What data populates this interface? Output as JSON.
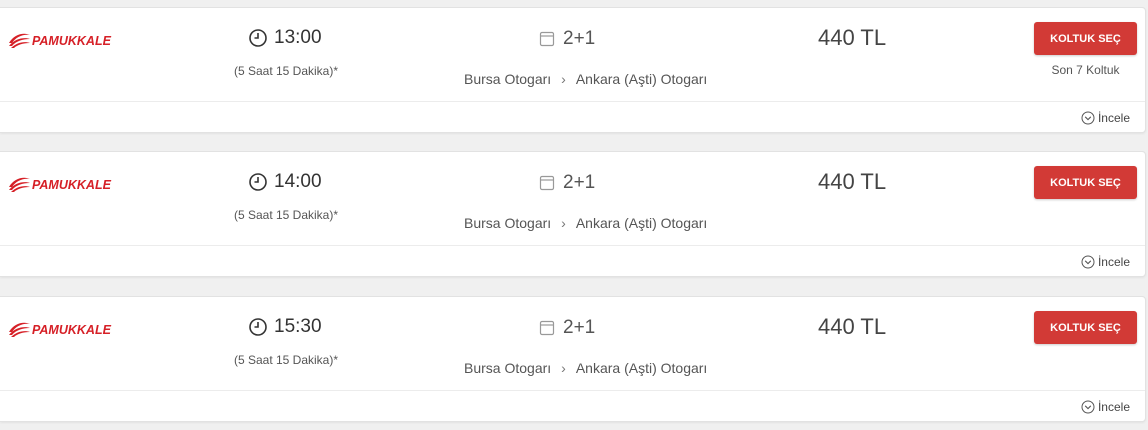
{
  "trips": [
    {
      "company": "PAMUKKALE",
      "time": "13:00",
      "duration": "(5 Saat 15 Dakika)*",
      "seat_layout": "2+1",
      "origin": "Bursa Otogarı",
      "destination": "Ankara (Aşti) Otogarı",
      "price": "440 TL",
      "button_label": "KOLTUK SEÇ",
      "seats_left": "Son 7 Koltuk",
      "details_label": "İncele"
    },
    {
      "company": "PAMUKKALE",
      "time": "14:00",
      "duration": "(5 Saat 15 Dakika)*",
      "seat_layout": "2+1",
      "origin": "Bursa Otogarı",
      "destination": "Ankara (Aşti) Otogarı",
      "price": "440 TL",
      "button_label": "KOLTUK SEÇ",
      "details_label": "İncele"
    },
    {
      "company": "PAMUKKALE",
      "time": "15:30",
      "duration": "(5 Saat 15 Dakika)*",
      "seat_layout": "2+1",
      "origin": "Bursa Otogarı",
      "destination": "Ankara (Aşti) Otogarı",
      "price": "440 TL",
      "button_label": "KOLTUK SEÇ",
      "details_label": "İncele"
    }
  ],
  "icons": {
    "clock": "clock-icon",
    "seat": "seat-icon",
    "route_arrow": "chevron-right-icon",
    "details": "chevron-down-circle-icon"
  },
  "colors": {
    "brand_red": "#d23a36",
    "logo_red": "#d62027"
  }
}
